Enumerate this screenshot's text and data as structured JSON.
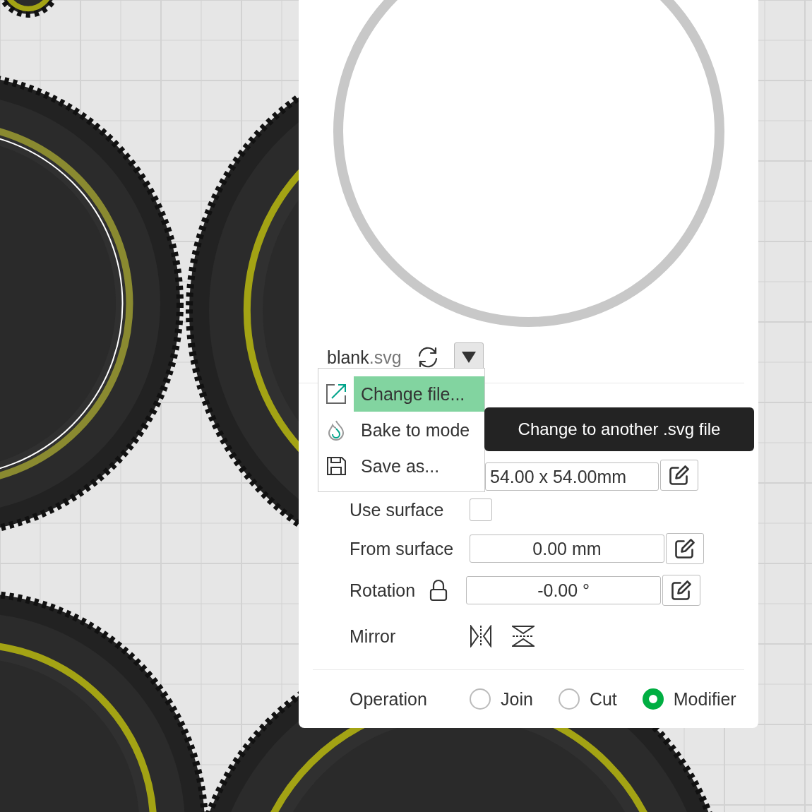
{
  "file": {
    "name": "blank",
    "extension": ".svg",
    "menu_open": true
  },
  "menu": [
    {
      "label": "Change file...",
      "selected": true
    },
    {
      "label": "Bake to mode",
      "selected": false
    },
    {
      "label": "Save as...",
      "selected": false
    }
  ],
  "tooltip": {
    "text": "Change to another .svg file"
  },
  "size_row": {
    "value": "54.00 x 54.00mm"
  },
  "use_surface": {
    "label": "Use surface",
    "checked": false
  },
  "from_surface": {
    "label": "From surface",
    "value": "0.00 mm"
  },
  "rotation": {
    "label": "Rotation",
    "value": "-0.00 °"
  },
  "mirror": {
    "label": "Mirror"
  },
  "operation": {
    "label": "Operation",
    "options": [
      {
        "label": "Join",
        "selected": false
      },
      {
        "label": "Cut",
        "selected": false
      },
      {
        "label": "Modifier",
        "selected": true
      }
    ]
  }
}
